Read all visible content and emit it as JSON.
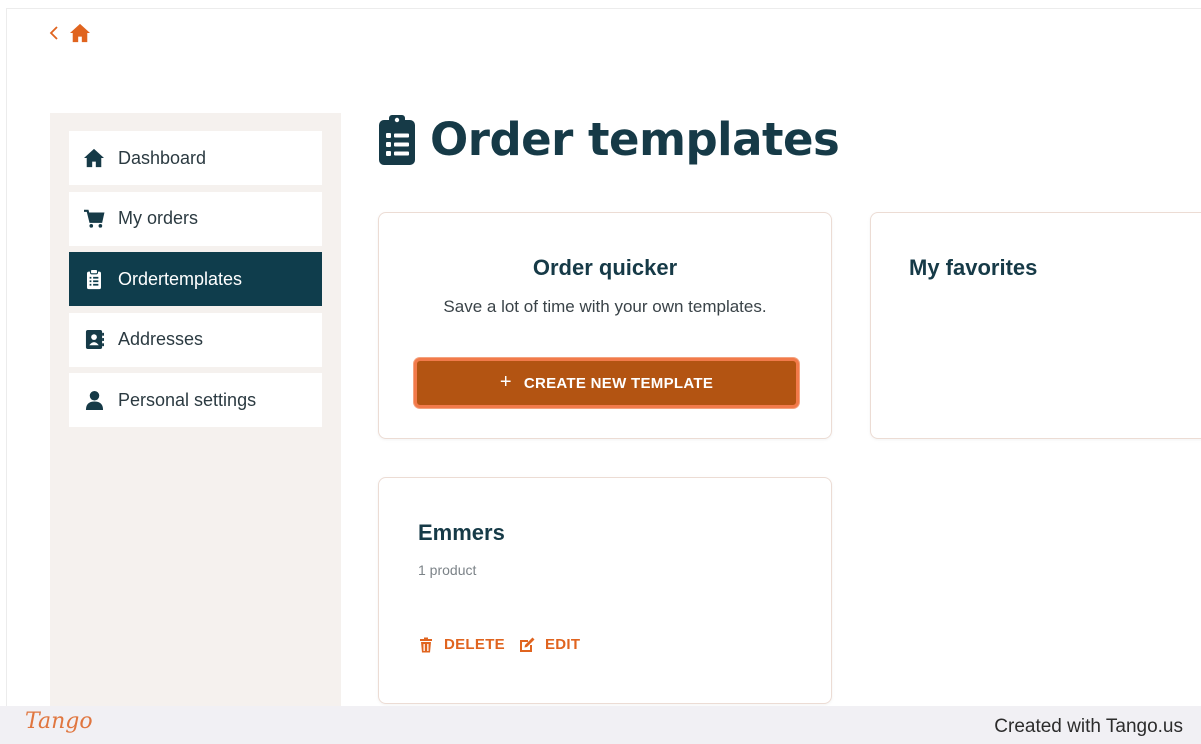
{
  "nav": {
    "back_icon": "chevron-left-icon",
    "home_icon": "home-icon"
  },
  "sidebar": {
    "items": [
      {
        "label": "Dashboard",
        "icon": "home-icon"
      },
      {
        "label": "My orders",
        "icon": "cart-icon"
      },
      {
        "label": "Ordertemplates",
        "icon": "clipboard-list-icon",
        "active": true
      },
      {
        "label": "Addresses",
        "icon": "address-book-icon"
      },
      {
        "label": "Personal settings",
        "icon": "user-icon"
      }
    ]
  },
  "page": {
    "title": "Order templates",
    "title_icon": "clipboard-list-icon"
  },
  "quicker_card": {
    "title": "Order quicker",
    "description": "Save a lot of time with your own templates.",
    "button_label": "CREATE NEW TEMPLATE"
  },
  "favorites_card": {
    "title": "My favorites"
  },
  "template_card": {
    "title": "Emmers",
    "count": "1 product",
    "delete_label": "DELETE",
    "edit_label": "EDIT"
  },
  "footer": {
    "logo": "Tango",
    "credit": "Created with Tango.us"
  },
  "colors": {
    "accent": "#e0641f",
    "button": "#b35412",
    "dark": "#0f3d4c",
    "sidebar_bg": "#f5f1ee"
  }
}
